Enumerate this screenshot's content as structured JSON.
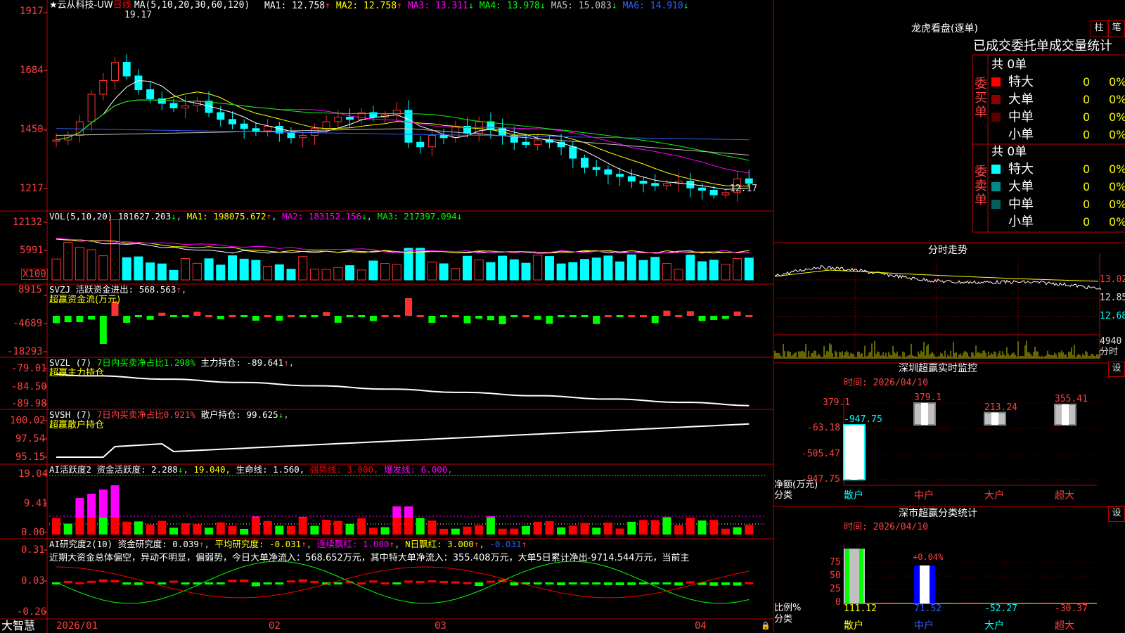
{
  "price_panel": {
    "stock_name": "★云从科技-UW",
    "period": "日线",
    "ma_header": "MA(5,10,20,30,60,120)",
    "ma": [
      {
        "label": "MA1: 12.758",
        "arrow": "↑",
        "color": "#ffffff"
      },
      {
        "label": "MA2: 12.758",
        "arrow": "↑",
        "color": "#ffff00"
      },
      {
        "label": "MA3: 13.311",
        "arrow": "↓",
        "color": "#ff00ff"
      },
      {
        "label": "MA4: 13.978",
        "arrow": "↓",
        "color": "#00ff00"
      },
      {
        "label": "MA5: 15.083",
        "arrow": "↓",
        "color": "#c0c0c0"
      },
      {
        "label": "MA6: 14.910",
        "arrow": "↓",
        "color": "#3060ff"
      }
    ],
    "y_ticks": [
      "1917",
      "1684",
      "1450",
      "1217"
    ],
    "high_marker": "19.17",
    "low_marker": "12.17"
  },
  "vol_panel": {
    "header": "VOL(5,10,20)",
    "value": "181627.203",
    "ma1": "MA1: 198075.672",
    "ma2": "MA2: 183152.156",
    "ma3": "MA3: 217397.094",
    "y_ticks": [
      "12132",
      "5991"
    ],
    "unit": "X100"
  },
  "svzj_panel": {
    "header": "SVZJ",
    "line1": "活跃资金进出: 568.563",
    "line2": "超赢资金流(万元)",
    "y_ticks": [
      "8915",
      "-4689",
      "-18293"
    ]
  },
  "svzl_panel": {
    "header": "SVZL (7)",
    "ratio": "7日内买卖净占比1.298%",
    "holding": "主力持仓: -89.641",
    "sub": "超赢主力持仓",
    "y_ticks": [
      "-79.01",
      "-84.50",
      "-89.98"
    ]
  },
  "svsh_panel": {
    "header": "SVSH (7)",
    "ratio": "7日内买卖净占比0.921%",
    "holding": "散户持仓: 99.625",
    "sub": "超赢散户持仓",
    "y_ticks": [
      "100.02",
      "97.54",
      "95.15"
    ]
  },
  "ai_active_panel": {
    "header": "AI活跃度2",
    "v1": "资金活跃度: 2.288",
    "v2": "19.040,",
    "v3": "生命线: 1.560,",
    "v4": "强势线: 3.000,",
    "v5": "爆发线: 6.000,",
    "y_ticks": [
      "19.04",
      "9.41",
      "0.00"
    ]
  },
  "ai_research_panel": {
    "header": "AI研究度2(10)",
    "v1": "资金研究度: 0.039",
    "v2": "平均研究度: -0.031",
    "v3": "连续飘红: 1.000",
    "v4": "N日飘红: 3.000",
    "v5": "-0.031",
    "commentary": "近期大资金总体偏空，异动不明显，偏弱势，今日大单净流入：568.652万元，其中特大单净流入：355.408万元，大单5日累计净出-9714.544万元，当前主",
    "y_ticks": [
      "0.31",
      "0.03",
      "-0.26"
    ]
  },
  "x_axis": {
    "labels": [
      "2026/01",
      "02",
      "03",
      "04"
    ]
  },
  "brand": "大智慧",
  "right_panel": {
    "lhb": {
      "title": "龙虎看盘(逐单)",
      "btn_column": "柱",
      "btn_detail": "笔",
      "tabs": "已成交委托单成交量统计",
      "buy_label": "委买单",
      "sell_label": "委卖单",
      "buy_total": "共 0单",
      "sell_total": "共 0单",
      "buy_rows": [
        {
          "name": "特大",
          "count": "0",
          "pct": "0%",
          "color": "#ff0000"
        },
        {
          "name": "大单",
          "count": "0",
          "pct": "0%",
          "color": "#8b0000"
        },
        {
          "name": "中单",
          "count": "0",
          "pct": "0%",
          "color": "#5a0000"
        },
        {
          "name": "小单",
          "count": "0",
          "pct": "0%",
          "color": ""
        }
      ],
      "sell_rows": [
        {
          "name": "特大",
          "count": "0",
          "pct": "0%",
          "color": "#00ffff"
        },
        {
          "name": "大单",
          "count": "0",
          "pct": "0%",
          "color": "#008b8b"
        },
        {
          "name": "中单",
          "count": "0",
          "pct": "0%",
          "color": "#006060"
        },
        {
          "name": "小单",
          "count": "0",
          "pct": "0%",
          "color": ""
        }
      ]
    },
    "intraday": {
      "title": "分时走势",
      "y_ticks": [
        "13.02",
        "12.85",
        "12.68"
      ],
      "vol_tick": "4940",
      "vol_label": "分时"
    },
    "sz_monitor": {
      "title": "深圳超赢实时监控",
      "settings": "设",
      "time": "时间: 2026/04/10",
      "y_ticks": [
        "379.1",
        "-63.18",
        "-505.47",
        "-947.75"
      ],
      "y_label": "净额(万元)",
      "x_label": "分类",
      "categories": [
        "散户",
        "中户",
        "大户",
        "超大"
      ],
      "values": [
        -947.75,
        379.1,
        213.24,
        355.41
      ],
      "value_labels": [
        "-947.75",
        "379.1",
        "213.24",
        "355.41"
      ]
    },
    "sz_class": {
      "title": "深市超赢分类统计",
      "settings": "设",
      "time": "时间: 2026/04/10",
      "y_ticks": [
        "75",
        "50",
        "25",
        "0"
      ],
      "y_label": "比例%",
      "x_label": "分类",
      "categories": [
        "散户",
        "中户",
        "大户",
        "超大"
      ],
      "values": [
        111.12,
        71.52,
        -52.27,
        -30.37
      ],
      "value_labels": [
        "111.12",
        "71.52",
        "-52.27",
        "-30.37"
      ],
      "annotation": "+0.04%"
    }
  }
}
